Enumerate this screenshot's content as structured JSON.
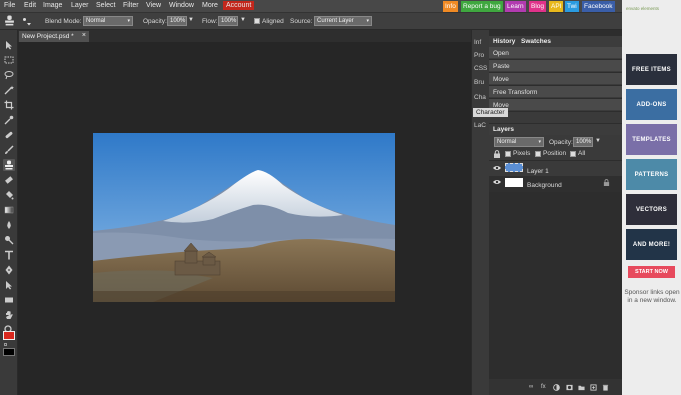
{
  "menu": {
    "items": [
      "File",
      "Edit",
      "Image",
      "Layer",
      "Select",
      "Filter",
      "View",
      "Window",
      "More",
      "Account"
    ],
    "top_buttons": [
      {
        "label": "Info",
        "color": "#f08a24"
      },
      {
        "label": "Report a bug",
        "color": "#3fa73f"
      },
      {
        "label": "Learn",
        "color": "#b23bb0"
      },
      {
        "label": "Blog",
        "color": "#e0328a"
      },
      {
        "label": "API",
        "color": "#e8b81c"
      },
      {
        "label": "Twi",
        "color": "#2a9be0"
      },
      {
        "label": "Facebook",
        "color": "#3a5ea8"
      }
    ]
  },
  "options": {
    "blend_mode_label": "Blend Mode:",
    "blend_mode_value": "Normal",
    "opacity_label": "Opacity:",
    "opacity_value": "100%",
    "flow_label": "Flow:",
    "flow_value": "100%",
    "aligned_label": "Aligned",
    "source_label": "Source:",
    "source_value": "Current Layer"
  },
  "tools": [
    "move-tool",
    "marquee-tool",
    "lasso-tool",
    "wand-tool",
    "crop-tool",
    "eyedropper-tool",
    "healing-tool",
    "brush-tool",
    "clone-stamp-tool",
    "eraser-tool",
    "fill-tool",
    "gradient-tool",
    "blur-tool",
    "dodge-tool",
    "type-tool",
    "pen-tool",
    "path-select-tool",
    "shape-tool",
    "hand-tool",
    "zoom-tool"
  ],
  "colors": {
    "foreground": "#d9281e",
    "background": "#000000",
    "accent": "#5b8fd4"
  },
  "document": {
    "tab_title": "New Project.psd *",
    "close_glyph": "×"
  },
  "panel_strip": [
    "Inf",
    "Pro",
    "CSS",
    "Bru",
    "Cha",
    "LaC"
  ],
  "character_tooltip": "Character",
  "history": {
    "tabs": [
      "History",
      "Swatches"
    ],
    "items": [
      "Open",
      "Paste",
      "Move",
      "Free Transform",
      "Move"
    ]
  },
  "layers": {
    "title": "Layers",
    "blend_value": "Normal",
    "opacity_label": "Opacity:",
    "opacity_value": "100%",
    "lock_pixels": "Pixels",
    "lock_position": "Position",
    "lock_all": "All",
    "items": [
      {
        "name": "Layer 1",
        "selected": true
      },
      {
        "name": "Background",
        "selected": false
      }
    ]
  },
  "ads": {
    "logo_text": "envato elements",
    "tiles": [
      {
        "label": "FREE ITEMS",
        "color": "#2a2f3c"
      },
      {
        "label": "ADD-ONS",
        "color": "#3b6ea2"
      },
      {
        "label": "TEMPLATES",
        "color": "#7a6fa8"
      },
      {
        "label": "PATTERNS",
        "color": "#4d8aa8"
      },
      {
        "label": "VECTORS",
        "color": "#2e2e3a"
      },
      {
        "label": "AND MORE!",
        "color": "#223448"
      }
    ],
    "start_now": "START NOW",
    "sponsor_text": "Sponsor links open in a new window."
  }
}
